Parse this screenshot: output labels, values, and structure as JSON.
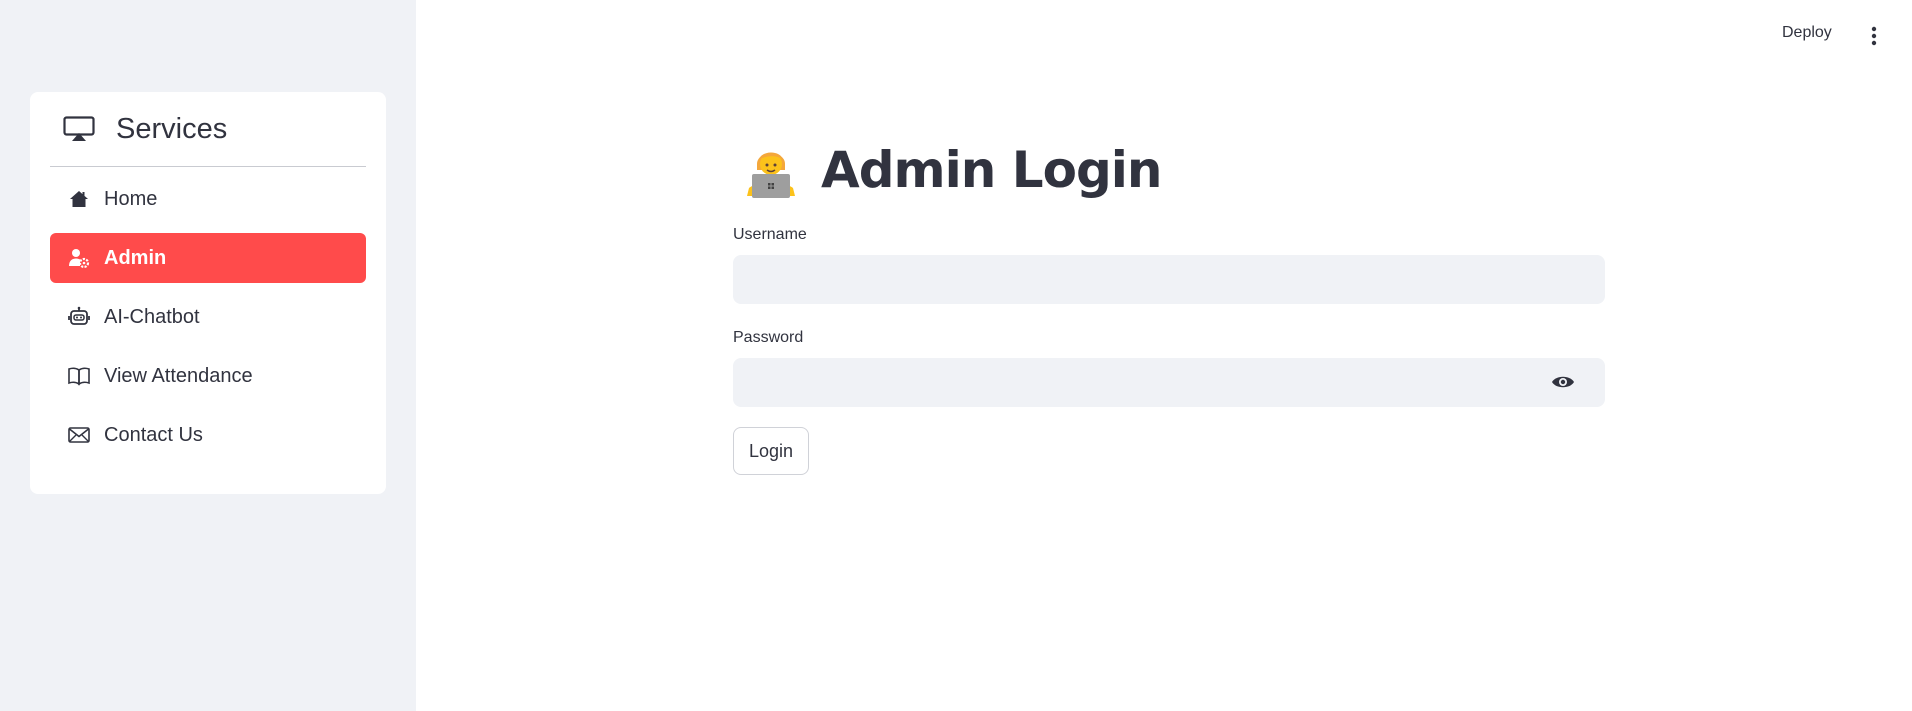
{
  "sidebar": {
    "title": "Services",
    "title_icon": "airplay-icon",
    "items": [
      {
        "label": "Home",
        "icon": "house-icon",
        "active": false
      },
      {
        "label": "Admin",
        "icon": "person-gear-icon",
        "active": true
      },
      {
        "label": "AI-Chatbot",
        "icon": "robot-icon",
        "active": false
      },
      {
        "label": "View Attendance",
        "icon": "book-icon",
        "active": false
      },
      {
        "label": "Contact Us",
        "icon": "envelope-icon",
        "active": false
      }
    ],
    "active_color": "#ff4b4b"
  },
  "header": {
    "deploy_label": "Deploy",
    "menu_icon": "more-vertical-icon"
  },
  "form": {
    "title": "Admin Login",
    "title_emoji": "technologist-emoji",
    "username_label": "Username",
    "username_value": "",
    "password_label": "Password",
    "password_value": "",
    "login_label": "Login"
  }
}
